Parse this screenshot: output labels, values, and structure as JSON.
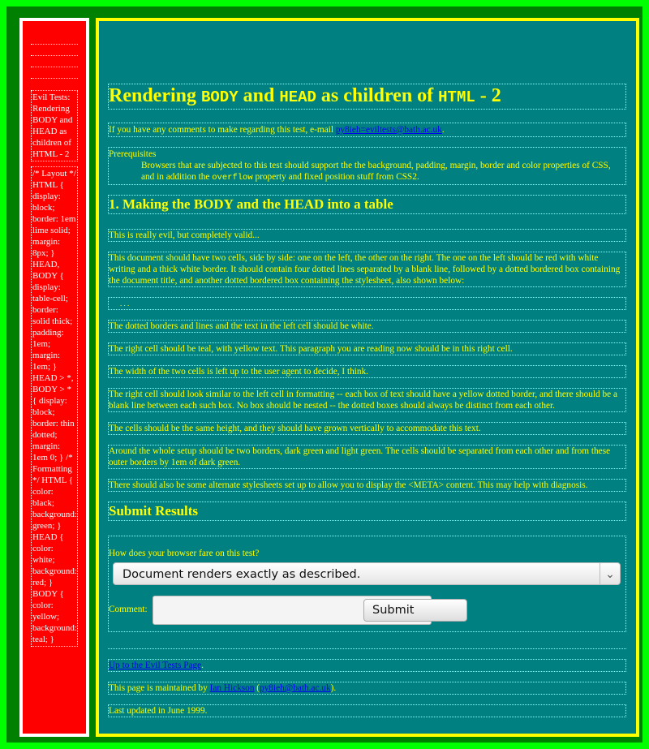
{
  "colors": {
    "outer": "#00ff00",
    "frame": "#008000",
    "left_bg": "#ff0000",
    "left_border": "#ffffff",
    "right_bg": "#008080",
    "right_border": "#ffff00",
    "right_text": "#ffff00"
  },
  "left": {
    "title_box": "Evil Tests: Rendering BODY and HEAD as children of HTML - 2",
    "style_box": "/* Layout */ HTML { display: block; border: 1em lime solid; margin: 8px; } HEAD, BODY { display: table-cell; border: solid thick; padding: 1em; margin: 1em; } HEAD > *, BODY > * { display: block; border: thin dotted; margin: 1em 0; } /* Formatting */ HTML { color: black; background: green; } HEAD { color: white; background: red; } BODY { color: yellow; background: teal; }"
  },
  "right": {
    "h1": {
      "pre": "Rendering ",
      "body": "BODY",
      "mid": " and ",
      "head": "HEAD",
      "mid2": " as children of ",
      "html": "HTML",
      "post": " - 2"
    },
    "comments": {
      "pre": "If you have any comments to make regarding this test, e-mail ",
      "email": "py8ieh=eviltests@bath.ac.uk",
      "post": "."
    },
    "prereq": {
      "title": "Prerequisites",
      "text_pre": "Browsers that are subjected to this test should support the the background, padding, margin, border and color properties of CSS, and in addition the ",
      "code": "overflow",
      "text_post": " property and fixed position stuff from CSS2."
    },
    "section1": "1. Making the BODY and the HEAD into a table",
    "p1": "This is really evil, but completely valid...",
    "p2": "This document should have two cells, side by side: one on the left, the other on the right. The one on the left should be red with white writing and a thick white border. It should contain four dotted lines separated by a blank line, followed by a dotted bordered box containing the document title, and another dotted bordered box containing the stylesheet, also shown below:",
    "p_ellipsis": ". . .",
    "p3": "The dotted borders and lines and the text in the left cell should be white.",
    "p4": "The right cell should be teal, with yellow text. This paragraph you are reading now should be in this right cell.",
    "p5": "The width of the two cells is left up to the user agent to decide, I think.",
    "p6": "The right cell should look similar to the left cell in formatting -- each box of text should have a yellow dotted border, and there should be a blank line between each such box. No box should be nested -- the dotted boxes should always be distinct from each other.",
    "p7": "The cells should be the same height, and they should have grown vertically to accommodate this text.",
    "p8": "Around the whole setup should be two borders, dark green and light green. The cells should be separated from each other and from these outer borders by 1em of dark green.",
    "p9": "There should also be some alternate stylesheets set up to allow you to display the <META> content. This may help with diagnosis.",
    "submit_heading": "Submit Results",
    "form": {
      "question": "How does your browser fare on this test?",
      "selected": "Document renders exactly as described.",
      "comment_label": "Comment:",
      "submit": "Submit"
    },
    "footer": {
      "up_link": "Up to the Evil Tests Page",
      "up_post": ".",
      "maintained_pre": "This page is maintained by ",
      "maintainer": "Ian Hickson",
      "paren_open": " (",
      "maintainer_email": "py8ieh@bath.ac.uk",
      "paren_close": ").",
      "updated": "Last updated in June 1999."
    }
  }
}
